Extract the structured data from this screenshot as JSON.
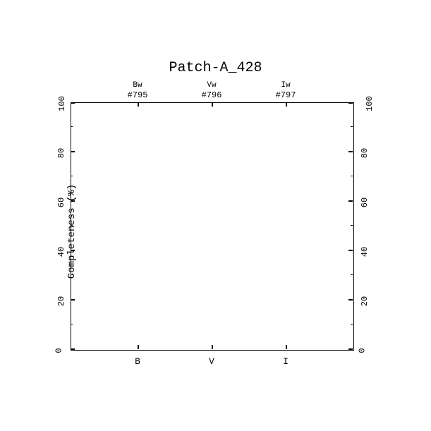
{
  "chart_data": {
    "type": "scatter",
    "title": "Patch-A_428",
    "ylabel": "Completeness (%)",
    "xlabel": "",
    "ylim": [
      0,
      100
    ],
    "yticks": [
      0,
      20,
      40,
      60,
      80,
      100
    ],
    "x_categories_bottom": [
      "B",
      "V",
      "I"
    ],
    "x_categories_top_row1": [
      "Bw",
      "Vw",
      "Iw"
    ],
    "x_categories_top_row2": [
      "#795",
      "#796",
      "#797"
    ],
    "series": []
  }
}
